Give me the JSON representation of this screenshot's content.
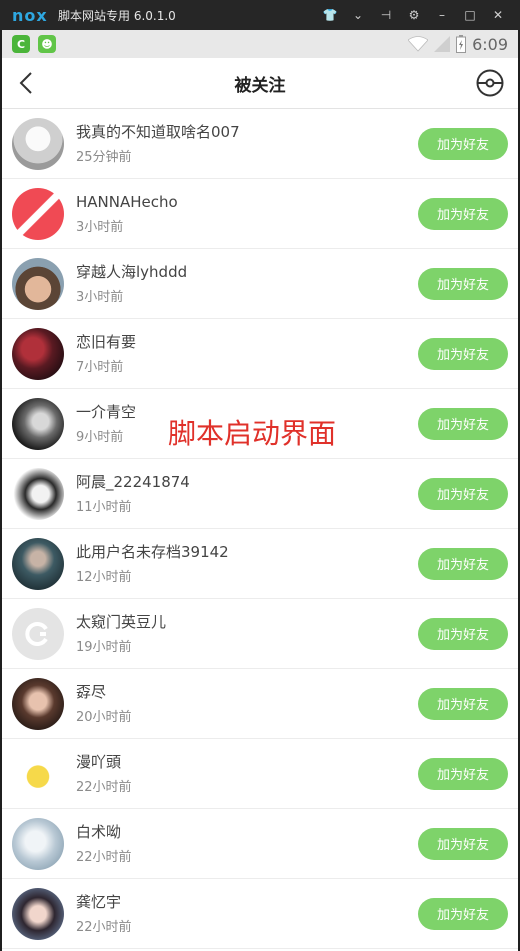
{
  "emulator": {
    "logo": "nox",
    "title": "脚本网站专用 6.0.1.0"
  },
  "status": {
    "time": "6:09"
  },
  "header": {
    "title": "被关注"
  },
  "list": {
    "action_label": "加为好友",
    "items": [
      {
        "name": "我真的不知道取啥名007",
        "time": "25分钟前"
      },
      {
        "name": "HANNAHecho",
        "time": "3小时前"
      },
      {
        "name": "穿越人海lyhddd",
        "time": "3小时前"
      },
      {
        "name": "恋旧有要",
        "time": "7小时前"
      },
      {
        "name": "一介青空",
        "time": "9小时前"
      },
      {
        "name": "阿晨_22241874",
        "time": "11小时前"
      },
      {
        "name": "此用户名未存档39142",
        "time": "12小时前"
      },
      {
        "name": "太窥门英豆儿",
        "time": "19小时前"
      },
      {
        "name": "孬尽",
        "time": "20小时前"
      },
      {
        "name": "漫吖頭",
        "time": "22小时前"
      },
      {
        "name": "白术呦",
        "time": "22小时前"
      },
      {
        "name": "龚忆宇",
        "time": "22小时前"
      }
    ]
  },
  "overlay": {
    "text": "脚本启动界面"
  },
  "colors": {
    "accent_green": "#7ed36a",
    "overlay_red": "#e0312a"
  }
}
